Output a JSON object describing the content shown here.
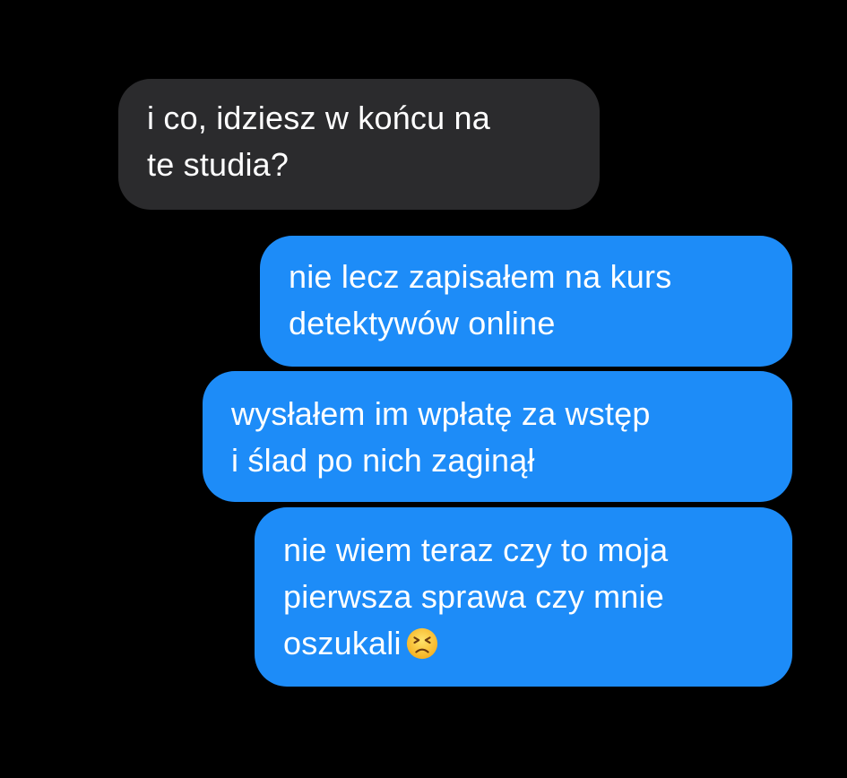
{
  "colors": {
    "background": "#000000",
    "incoming_bubble": "#2b2b2d",
    "outgoing_bubble": "#1d8cf8",
    "text": "#ffffff"
  },
  "messages": [
    {
      "direction": "incoming",
      "lines": [
        "i co, idziesz w końcu na",
        "te studia?"
      ]
    },
    {
      "direction": "outgoing",
      "lines": [
        "nie lecz zapisałem na kurs",
        "detektywów online"
      ]
    },
    {
      "direction": "outgoing",
      "lines": [
        "wysłałem im wpłatę za wstęp",
        "i ślad po nich zaginął"
      ]
    },
    {
      "direction": "outgoing",
      "lines": [
        "nie wiem teraz czy to moja",
        "pierwsza sprawa czy mnie",
        "oszukali"
      ],
      "emoji": "persevering-face-emoji"
    }
  ]
}
